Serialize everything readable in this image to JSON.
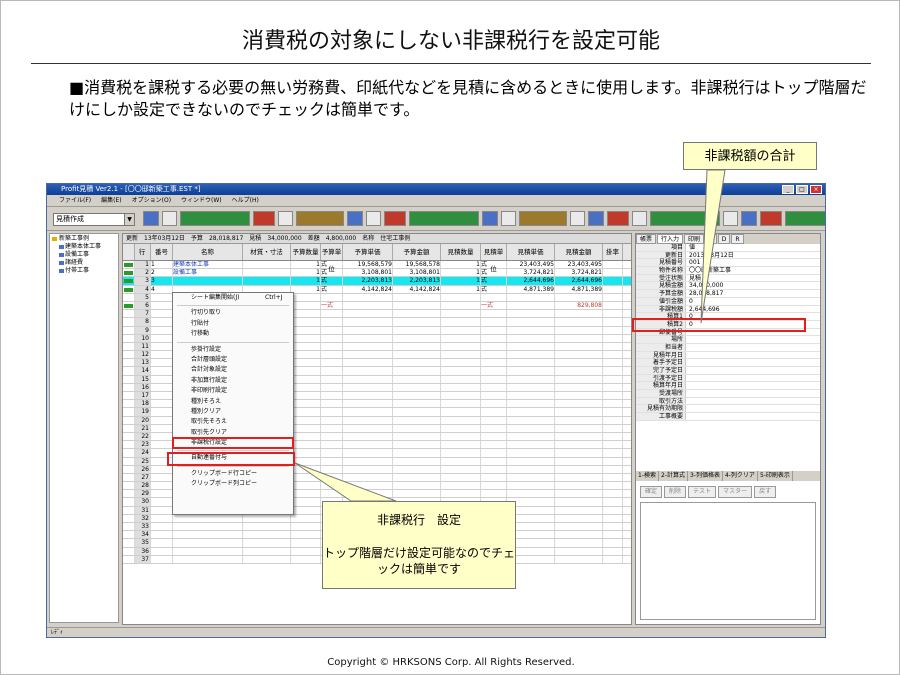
{
  "slide": {
    "title": "消費税の対象にしない非課税行を設定可能",
    "lead": "■消費税を課税する必要の無い労務費、印紙代などを見積に含めるときに使用します。非課税行はトップ階層だけにしか設定できないのでチェックは簡単です。",
    "copyright": "Copyright ©  HRKSONS Corp.   All Rights Reserved."
  },
  "callouts": {
    "total": "非課税額の合計",
    "setting_title": "非課税行　設定",
    "setting_body": "トップ階層だけ設定可能なのでチェックは簡単です"
  },
  "app": {
    "title": "Profit見積 Ver2.1 - [〇〇邸新築工事.EST *]",
    "menu": [
      "ファイル(F)",
      "編集(E)",
      "オプション(O)",
      "ウィンドウ(W)",
      "ヘルプ(H)"
    ],
    "mode": "見積作成",
    "tree": [
      "新築工事例",
      "建築本体工事",
      "設備工事",
      "諸経費",
      "付帯工事"
    ],
    "info": {
      "date_label": "更新",
      "date": "13年03月12日",
      "budget_label": "予算",
      "budget": "28,018,817",
      "estimate_label": "見積",
      "estimate": "34,000,000",
      "profit_label": "差額",
      "profit": "4,800,000",
      "name_label": "名称",
      "name": "住宅工事例"
    },
    "headers": [
      "行",
      "番号",
      "名称",
      "材質・寸法",
      "予算数量",
      "予算単位",
      "予算単価",
      "予算金額",
      "見積数量",
      "見積単位",
      "見積単価",
      "見積金額",
      "掛率"
    ],
    "rows": [
      {
        "no": "1",
        "code": "1",
        "name": "建築本体工事",
        "spec": "",
        "qty": "1",
        "unit": "式",
        "up": "19,568,579",
        "amt": "19,568,578",
        "eqty": "1",
        "eunit": "式",
        "eup": "23,403,495",
        "eamt": "23,403,495"
      },
      {
        "no": "2",
        "code": "2",
        "name": "設備工事",
        "spec": "",
        "qty": "1",
        "unit": "式",
        "up": "3,108,801",
        "amt": "3,108,801",
        "eqty": "1",
        "eunit": "式",
        "eup": "3,724,821",
        "eamt": "3,724,821"
      },
      {
        "no": "3",
        "code": "3",
        "name": "",
        "spec": "",
        "qty": "1",
        "unit": "式",
        "up": "2,203,813",
        "amt": "2,203,813",
        "eqty": "1",
        "eunit": "式",
        "eup": "2,644,696",
        "eamt": "2,644,696"
      },
      {
        "no": "4",
        "code": "4",
        "name": "",
        "spec": "",
        "qty": "1",
        "unit": "式",
        "up": "4,142,824",
        "amt": "4,142,824",
        "eqty": "1",
        "eunit": "式",
        "eup": "4,871,389",
        "eamt": "4,871,389"
      },
      {
        "no": "5"
      },
      {
        "no": "6",
        "unit": "一式",
        "eunit": "一式",
        "eamt": "829,808"
      },
      {
        "no": "7"
      },
      {
        "no": "8"
      },
      {
        "no": "9"
      },
      {
        "no": "10"
      },
      {
        "no": "11"
      },
      {
        "no": "12"
      },
      {
        "no": "13"
      },
      {
        "no": "14"
      },
      {
        "no": "15"
      },
      {
        "no": "16"
      },
      {
        "no": "17"
      },
      {
        "no": "18"
      },
      {
        "no": "19"
      },
      {
        "no": "20"
      },
      {
        "no": "21"
      },
      {
        "no": "22"
      },
      {
        "no": "23"
      },
      {
        "no": "24"
      },
      {
        "no": "25"
      },
      {
        "no": "26"
      },
      {
        "no": "27"
      },
      {
        "no": "28"
      },
      {
        "no": "29"
      },
      {
        "no": "30"
      },
      {
        "no": "31"
      },
      {
        "no": "32"
      },
      {
        "no": "33"
      },
      {
        "no": "34"
      },
      {
        "no": "35"
      },
      {
        "no": "36"
      },
      {
        "no": "37"
      }
    ],
    "context_menu": [
      {
        "label": "シート編集開始(J)",
        "shortcut": "Ctrl+J"
      },
      {
        "sep": true
      },
      {
        "label": "行切り取り"
      },
      {
        "label": "行貼付"
      },
      {
        "label": "行移動"
      },
      {
        "sep": true
      },
      {
        "label": "歩掛行設定"
      },
      {
        "label": "合計層頭設定"
      },
      {
        "label": "合計対象設定"
      },
      {
        "label": "非加算行設定"
      },
      {
        "label": "非印刷行設定"
      },
      {
        "label": "種別そろえ"
      },
      {
        "label": "種別クリア"
      },
      {
        "label": "取引先そろえ"
      },
      {
        "label": "取引先クリア"
      },
      {
        "label": "非課税行設定",
        "selected": true
      },
      {
        "sep": true
      },
      {
        "label": "自動連番付与"
      },
      {
        "sep": true
      },
      {
        "label": "クリップボード行コピー"
      },
      {
        "label": "クリップボード列コピー"
      }
    ],
    "right_tabs": [
      "帳票",
      "行入力",
      "印刷",
      "T",
      "D",
      "R"
    ],
    "props": [
      {
        "k": "項目",
        "v": "値"
      },
      {
        "k": "更新日",
        "v": "2013年3月12日"
      },
      {
        "k": "見積番号",
        "v": "001"
      },
      {
        "k": "物件名称",
        "v": "〇〇邸新築工事"
      },
      {
        "k": "受注状態",
        "v": "見積"
      },
      {
        "k": "見積金額",
        "v": "34,000,000"
      },
      {
        "k": "予算金額",
        "v": "28,018,817"
      },
      {
        "k": "値引金額",
        "v": "0"
      },
      {
        "k": "非課税額",
        "v": "2,644,696"
      },
      {
        "k": "積算1",
        "v": "0"
      },
      {
        "k": "積算2",
        "v": "0"
      },
      {
        "k": "郵便番号",
        "v": ""
      },
      {
        "k": "場所",
        "v": ""
      },
      {
        "k": "担当者",
        "v": ""
      },
      {
        "k": "見積年月日",
        "v": ""
      },
      {
        "k": "着手予定日",
        "v": ""
      },
      {
        "k": "完了予定日",
        "v": ""
      },
      {
        "k": "引渡予定日",
        "v": ""
      },
      {
        "k": "積算年月日",
        "v": ""
      },
      {
        "k": "受渡場所",
        "v": ""
      },
      {
        "k": "取引方法",
        "v": ""
      },
      {
        "k": "見積有効期限",
        "v": ""
      },
      {
        "k": "工事概要",
        "v": ""
      }
    ],
    "bottom_tabs": [
      "1-検索",
      "2-計算式",
      "3-列価格表",
      "4-列クリア",
      "5-印刷表示"
    ],
    "bottom_buttons": [
      "確定",
      "削除",
      "テスト",
      "マスター",
      "戻す"
    ],
    "status": "ﾚﾃﾞｨ"
  }
}
